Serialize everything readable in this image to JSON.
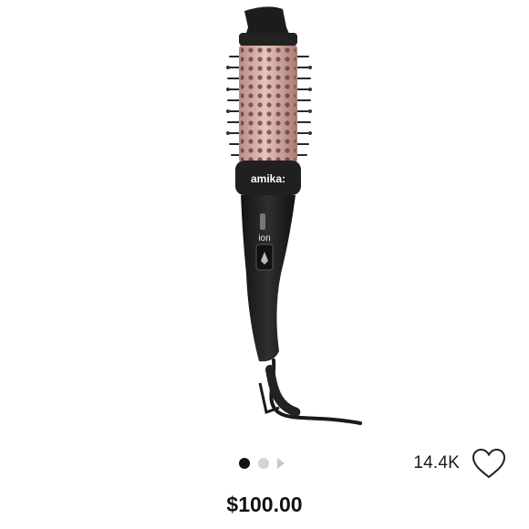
{
  "product": {
    "brand_logo_text": "amika:",
    "switch_label": "ion",
    "price": "$100.00"
  },
  "carousel": {
    "image_count": 2,
    "active_index": 0
  },
  "likes": {
    "count": "14.4K"
  },
  "colors": {
    "barrel_pink": "#d8a9a3",
    "handle_black": "#1e1e1e",
    "active_dot": "#111111",
    "inactive_dot": "#d4d4d4"
  },
  "icons": [
    "heart-icon",
    "next-arrow-icon"
  ]
}
